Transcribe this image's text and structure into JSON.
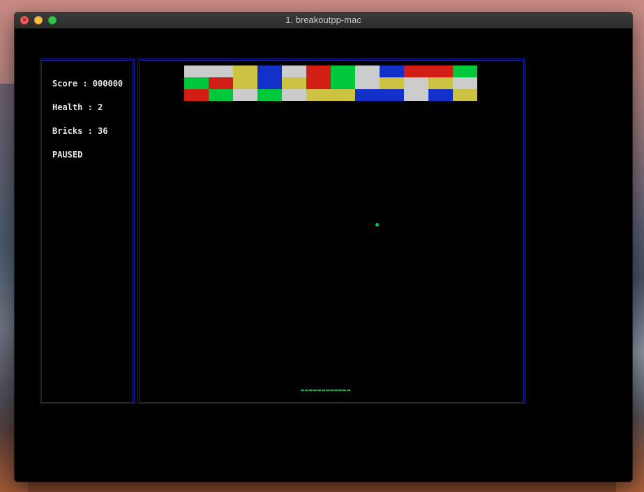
{
  "window": {
    "title": "1. breakoutpp-mac"
  },
  "stats": {
    "score": "Score : 000000",
    "health": "Health : 2",
    "bricks": "Bricks : 36",
    "status": "PAUSED"
  },
  "colors": {
    "panel_border": "#1b2294",
    "ball": "#00c83c",
    "paddle": "#00c83c",
    "brick_palette": {
      "W": "#cccccc",
      "Y": "#cdc343",
      "B": "#1030c8",
      "R": "#d21e14",
      "G": "#00c83c"
    }
  },
  "game": {
    "brick_rows": [
      [
        "W",
        "W",
        "Y",
        "B",
        "W",
        "R",
        "G",
        "W",
        "B",
        "R",
        "R",
        "G"
      ],
      [
        "G",
        "R",
        "Y",
        "B",
        "Y",
        "R",
        "G",
        "W",
        "Y",
        "W",
        "Y",
        "W"
      ],
      [
        "R",
        "G",
        "W",
        "G",
        "W",
        "Y",
        "Y",
        "B",
        "B",
        "W",
        "B",
        "Y"
      ]
    ],
    "ball_icon": "ball-icon",
    "paddle_icon": "paddle-icon"
  }
}
